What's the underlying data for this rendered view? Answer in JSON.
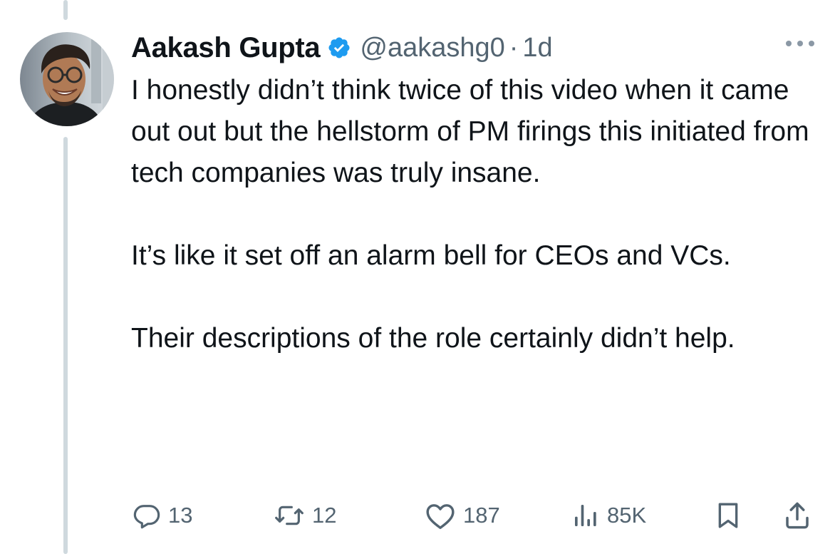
{
  "tweet": {
    "author_name": "Aakash Gupta",
    "handle": "@aakashg0",
    "separator": "·",
    "time": "1d",
    "paragraphs": [
      "I honestly didn’t think twice of this video when it came out out but the hellstorm of PM firings this initiated from tech companies was truly insane.",
      "It’s like it set off an alarm bell for CEOs and VCs.",
      "Their descriptions of the role certainly didn’t help."
    ]
  },
  "actions": {
    "replies": "13",
    "reposts": "12",
    "likes": "187",
    "views": "85K"
  },
  "icons": {
    "verified": "verified-badge-icon",
    "more": "more-icon",
    "reply": "reply-icon",
    "repost": "repost-icon",
    "like": "heart-icon",
    "views": "views-icon",
    "bookmark": "bookmark-icon",
    "share": "share-icon"
  },
  "colors": {
    "text_primary": "#0f1419",
    "text_secondary": "#536471",
    "verified_blue": "#1d9bf0",
    "thread_line": "#cfd9de"
  }
}
